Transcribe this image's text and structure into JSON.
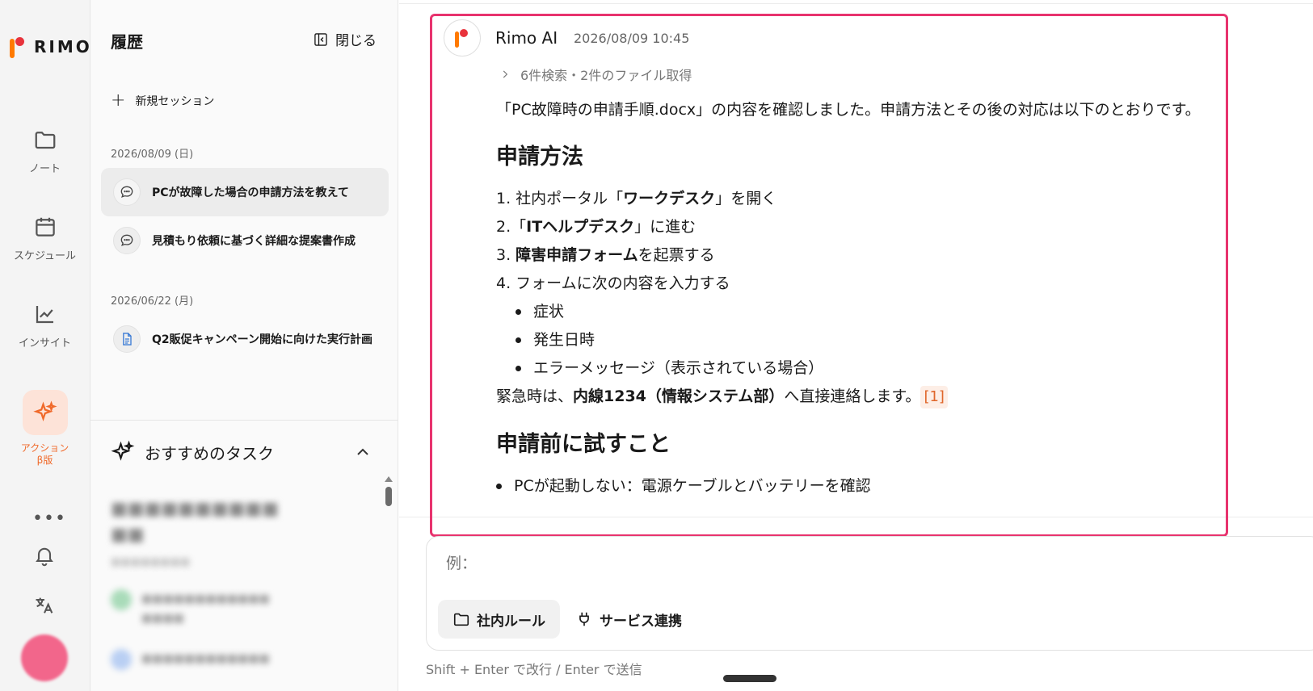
{
  "app": {
    "logo_text": "RIMO"
  },
  "rail": {
    "items": [
      {
        "label": "ノート",
        "icon": "folder-icon"
      },
      {
        "label": "スケジュール",
        "icon": "calendar-icon"
      },
      {
        "label": "インサイト",
        "icon": "chart-line-icon"
      }
    ],
    "action": {
      "label": "アクション",
      "badge": "β版",
      "icon": "sparkle-icon",
      "color": "#f06a2b"
    },
    "more": "•••"
  },
  "history": {
    "title": "履歴",
    "close_label": "閉じる",
    "new_session_label": "新規セッション",
    "groups": [
      {
        "date": "2026/08/09 (日)",
        "sessions": [
          {
            "title": "PCが故障した場合の申請方法を教えて",
            "icon": "chat-bubble-icon",
            "active": true
          },
          {
            "title": "見積もり依頼に基づく詳細な提案書作成",
            "icon": "chat-bubble-icon",
            "active": false
          }
        ]
      },
      {
        "date": "2026/06/22 (月)",
        "sessions": [
          {
            "title": "Q2販促キャンペーン開始に向けた実行計画",
            "icon": "document-icon",
            "active": false
          }
        ]
      }
    ],
    "recommended_title": "おすすめのタスク"
  },
  "message": {
    "author": "Rimo AI",
    "timestamp": "2026/08/09 10:45",
    "tool_summary": "6件検索・2件のファイル取得",
    "intro": "「PC故障時の申請手順.docx」の内容を確認しました。申請方法とその後の対応は以下のとおりです。",
    "section1_title": "申請方法",
    "steps": {
      "s1_pre": "1. 社内ポータル「",
      "s1_bold": "ワークデスク",
      "s1_post": "」を開く",
      "s2_pre": "2.「",
      "s2_bold": "ITヘルプデスク",
      "s2_post": "」に進む",
      "s3_pre": "3. ",
      "s3_bold": "障害申請フォーム",
      "s3_post": "を起票する",
      "s4": "4. フォームに次の内容を入力する"
    },
    "sub_items": [
      "症状",
      "発生日時",
      "エラーメッセージ（表示されている場合）"
    ],
    "urgent_pre": "緊急時は、",
    "urgent_bold": "内線1234（情報システム部）",
    "urgent_post": "へ直接連絡します。",
    "citation": "[1]",
    "section2_title": "申請前に試すこと",
    "tips": [
      "PCが起動しない：電源ケーブルとバッテリーを確認"
    ],
    "highlight_color": "#e8336e"
  },
  "composer": {
    "placeholder": "例：",
    "chip_rules": "社内ルール",
    "chip_services": "サービス連携",
    "hint": "Shift + Enter で改行 / Enter で送信"
  }
}
